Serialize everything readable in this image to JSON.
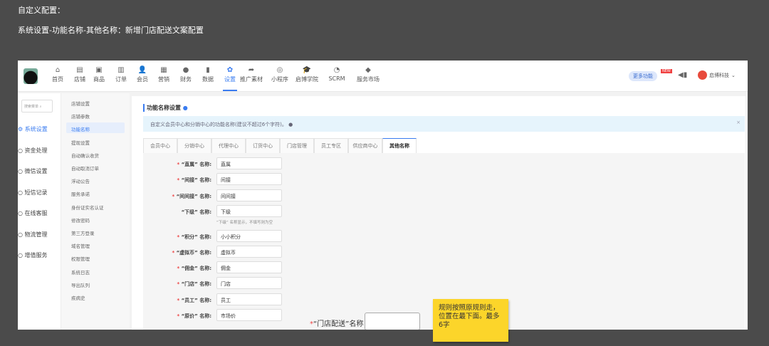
{
  "notes": {
    "line1": "自定义配置：",
    "line2": "系统设置-功能名称-其他名称：新增门店配送文案配置"
  },
  "nav": {
    "items": [
      {
        "label": "首页",
        "icon": "home-icon",
        "glyph": "⌂"
      },
      {
        "label": "店铺",
        "icon": "store-icon",
        "glyph": "▤"
      },
      {
        "label": "商品",
        "icon": "goods-icon",
        "glyph": "▣"
      },
      {
        "label": "订单",
        "icon": "order-icon",
        "glyph": "▥"
      },
      {
        "label": "会员",
        "icon": "member-icon",
        "glyph": "👤"
      },
      {
        "label": "营销",
        "icon": "marketing-icon",
        "glyph": "▦"
      },
      {
        "label": "财务",
        "icon": "finance-icon",
        "glyph": "●"
      },
      {
        "label": "数据",
        "icon": "data-icon",
        "glyph": "▮"
      },
      {
        "label": "设置",
        "icon": "settings-icon",
        "glyph": "✿"
      },
      {
        "label": "推广素材",
        "icon": "share-icon",
        "glyph": "➦"
      },
      {
        "label": "小程序",
        "icon": "miniapp-icon",
        "glyph": "◎"
      },
      {
        "label": "启博学院",
        "icon": "academy-icon",
        "glyph": "🎓"
      },
      {
        "label": "SCRM",
        "icon": "scrm-icon",
        "glyph": "◔"
      },
      {
        "label": "服务市场",
        "icon": "market-icon",
        "glyph": "◆"
      }
    ],
    "active": 8,
    "more": "更多功能",
    "new_badge": "NEW",
    "brand": "启博科技"
  },
  "sidebar1": {
    "search_placeholder": "搜索菜单",
    "items": [
      "系统设置",
      "资金处理",
      "微信设置",
      "短信记录",
      "在线客服",
      "物流管理",
      "增值服务"
    ]
  },
  "sidebar2": {
    "items": [
      "店铺设置",
      "店铺参数",
      "功能名称",
      "提现设置",
      "自动确认收货",
      "自动取消订单",
      "浮动公告",
      "服务承诺",
      "身份证实名认证",
      "修改密码",
      "第三方登录",
      "域名管理",
      "权限管理",
      "系统日志",
      "导出队列",
      "疾病史"
    ]
  },
  "main": {
    "title": "功能名称设置",
    "info": "自定义会员中心和分销中心的功能名称(建议不超过6个字符)。",
    "tabs": [
      "会员中心",
      "分销中心",
      "代理中心",
      "订货中心",
      "门店管理",
      "员工专区",
      "供应商中心",
      "其他名称"
    ],
    "fields": [
      {
        "label": "“直属” 名称:",
        "value": "直属",
        "required": true
      },
      {
        "label": "“间接” 名称:",
        "value": "间接",
        "required": true
      },
      {
        "label": "“间间接” 名称:",
        "value": "间间接",
        "required": true
      },
      {
        "label": "“下级” 名称:",
        "value": "下级",
        "required": false,
        "hint": "“下级” 名称显示，不填写则为空"
      },
      {
        "label": "“积分” 名称:",
        "value": "小小积分",
        "required": true
      },
      {
        "label": "“虚拟币” 名称:",
        "value": "虚拟币",
        "required": true
      },
      {
        "label": "“佣金” 名称:",
        "value": "佣金",
        "required": true
      },
      {
        "label": "“门店” 名称:",
        "value": "门店",
        "required": true
      },
      {
        "label": "“员工” 名称:",
        "value": "员工",
        "required": true
      },
      {
        "label": "“原价” 名称:",
        "value": "市场价",
        "required": true
      }
    ],
    "store_delivery_label": "“门店配送”名称",
    "store_delivery_value": ""
  },
  "sticky_note": "规则按照原规则走，位置在最下面。最多6字"
}
